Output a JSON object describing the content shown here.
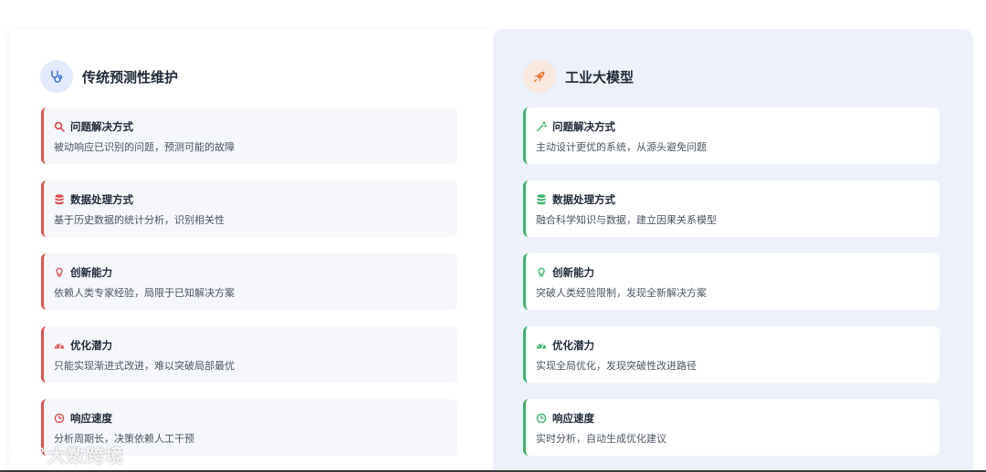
{
  "left": {
    "title": "传统预测性维护",
    "icon": "stethoscope-icon",
    "accent": "#e05252",
    "cards": [
      {
        "title": "问题解决方式",
        "desc": "被动响应已识别的问题，预测可能的故障",
        "icon": "search-icon"
      },
      {
        "title": "数据处理方式",
        "desc": "基于历史数据的统计分析，识别相关性",
        "icon": "database-icon"
      },
      {
        "title": "创新能力",
        "desc": "依赖人类专家经验，局限于已知解决方案",
        "icon": "lightbulb-icon"
      },
      {
        "title": "优化潜力",
        "desc": "只能实现渐进式改进，难以突破局部最优",
        "icon": "gauge-icon"
      },
      {
        "title": "响应速度",
        "desc": "分析周期长，决策依赖人工干预",
        "icon": "clock-icon"
      }
    ]
  },
  "right": {
    "title": "工业大模型",
    "icon": "rocket-icon",
    "accent": "#3cb46a",
    "cards": [
      {
        "title": "问题解决方式",
        "desc": "主动设计更优的系统，从源头避免问题",
        "icon": "magic-wand-icon"
      },
      {
        "title": "数据处理方式",
        "desc": "融合科学知识与数据，建立因果关系模型",
        "icon": "database-icon"
      },
      {
        "title": "创新能力",
        "desc": "突破人类经验限制，发现全新解决方案",
        "icon": "lightbulb-icon"
      },
      {
        "title": "优化潜力",
        "desc": "实现全局优化，发现突破性改进路径",
        "icon": "gauge-icon"
      },
      {
        "title": "响应速度",
        "desc": "实时分析，自动生成优化建议",
        "icon": "clock-icon"
      }
    ]
  },
  "watermark": {
    "text": "大数跨境"
  }
}
